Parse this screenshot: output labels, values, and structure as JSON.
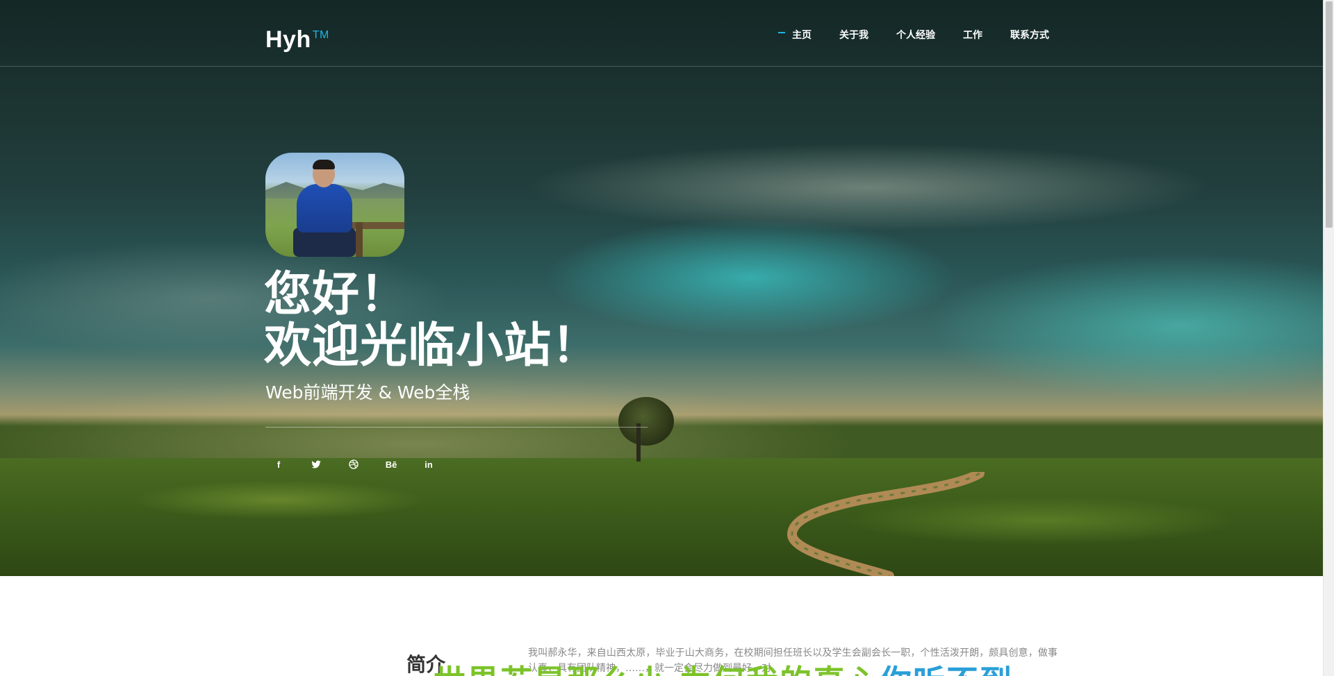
{
  "header": {
    "logo": "Hyh",
    "logo_sup": "TM",
    "nav": [
      {
        "label": "主页",
        "active": true
      },
      {
        "label": "关于我",
        "active": false
      },
      {
        "label": "个人经验",
        "active": false
      },
      {
        "label": "工作",
        "active": false
      },
      {
        "label": "联系方式",
        "active": false
      }
    ]
  },
  "hero": {
    "greeting_line1": "您好！",
    "greeting_line2": "欢迎光临小站！",
    "subtitle": "Web前端开发 & Web全栈",
    "social": [
      {
        "icon": "facebook-icon",
        "glyph": "f"
      },
      {
        "icon": "twitter-icon",
        "glyph": ""
      },
      {
        "icon": "dribbble-icon",
        "glyph": ""
      },
      {
        "icon": "behance-icon",
        "glyph": "Bē"
      },
      {
        "icon": "linkedin-icon",
        "glyph": "in"
      }
    ]
  },
  "intro": {
    "heading": "简介",
    "text": "我叫郝永华，来自山西太原，毕业于山大商务，在校期间担任班长以及学生会副会长一职，个性活泼开朗，颇具创意，做事认真，具有团队精神，……，就一定会尽力做到最好，对",
    "banner_green": "世界若是那么小 为何我的真心",
    "banner_blue": "你听不到"
  },
  "colors": {
    "accent": "#1bb6e8",
    "banner_green": "#7cc32a",
    "banner_blue": "#2a9fd8"
  }
}
